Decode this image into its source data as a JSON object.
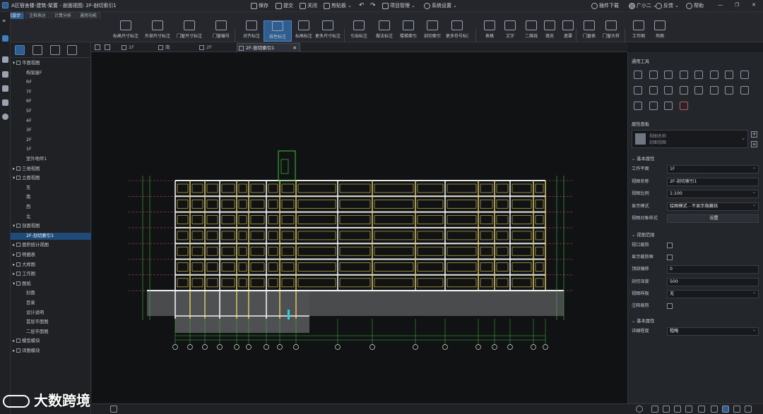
{
  "titlebar": {
    "doc_title": "A区宿舍楼-建筑-架置 - 剖面视图: 2F-剖切索引1",
    "save": "保存",
    "submit": "提交",
    "close": "关闭",
    "clipboard": "剪贴板",
    "project_mgmt": "项目管理",
    "system_settings": "系统设置",
    "plugin_download": "插件下载",
    "user": "广小二",
    "feedback": "反馈",
    "help": "帮助"
  },
  "ribbon_tabs": [
    "建筑设计",
    "注释表达",
    "计算分析",
    "通用功能"
  ],
  "ribbon_buttons": [
    "标高尺寸标注",
    "外部尺寸标注",
    "门窗尺寸标注",
    "门窗编号",
    "对齐标注",
    "线性标注",
    "标高标注",
    "更多尺寸标注",
    "引出标注",
    "做法标注",
    "楼梯索引",
    "剖切索引",
    "更多符号标注",
    "表格",
    "文字",
    "二维线",
    "填充",
    "遮罩",
    "门窗表",
    "门窗大样",
    "工作图",
    "布图"
  ],
  "tree": [
    {
      "label": "平面视图",
      "level": 0,
      "expanded": true
    },
    {
      "label": "构架屋F",
      "level": 1
    },
    {
      "label": "RF",
      "level": 1
    },
    {
      "label": "7F",
      "level": 1
    },
    {
      "label": "6F",
      "level": 1
    },
    {
      "label": "5F",
      "level": 1
    },
    {
      "label": "4F",
      "level": 1
    },
    {
      "label": "3F",
      "level": 1
    },
    {
      "label": "2F",
      "level": 1
    },
    {
      "label": "1F",
      "level": 1
    },
    {
      "label": "室外地坪1",
      "level": 1
    },
    {
      "label": "三维视图",
      "level": 0,
      "expanded": false
    },
    {
      "label": "立面视图",
      "level": 0,
      "expanded": true
    },
    {
      "label": "东",
      "level": 1
    },
    {
      "label": "南",
      "level": 1
    },
    {
      "label": "西",
      "level": 1
    },
    {
      "label": "北",
      "level": 1
    },
    {
      "label": "剖面视图",
      "level": 0,
      "expanded": true
    },
    {
      "label": "2F-剖切索引1",
      "level": 1,
      "selected": true
    },
    {
      "label": "面积统计视图",
      "level": 0
    },
    {
      "label": "明细表",
      "level": 0
    },
    {
      "label": "大样图",
      "level": 0
    },
    {
      "label": "工作图",
      "level": 0
    },
    {
      "label": "图纸",
      "level": 0,
      "expanded": true
    },
    {
      "label": "封面",
      "level": 1
    },
    {
      "label": "目录",
      "level": 1
    },
    {
      "label": "设计说明",
      "level": 1
    },
    {
      "label": "首层平面图",
      "level": 1
    },
    {
      "label": "二层平面图",
      "level": 1
    },
    {
      "label": "模型模块",
      "level": 0
    },
    {
      "label": "详图模块",
      "level": 0
    }
  ],
  "doc_tabs": [
    "1F",
    "南",
    "2F",
    "2F-剖切索引1"
  ],
  "right_panel": {
    "tools_title": "通用工具",
    "props_title": "属性面板",
    "view_name_hint": "视图名称",
    "view_type_hint": "剖面视图",
    "basic_props": "基本属性",
    "view_range": "视图范围",
    "basic_props2": "基本属性",
    "props": [
      {
        "label": "工作平面",
        "value": "1F",
        "type": "select"
      },
      {
        "label": "视图名称",
        "value": "2F-剖切索引1",
        "type": "text"
      },
      {
        "label": "视图比例",
        "value": "1:100",
        "type": "select"
      },
      {
        "label": "显示模式",
        "value": "绘图模式 - 不显示隐藏线",
        "type": "select"
      },
      {
        "label": "视图对象样式",
        "value": "设置",
        "type": "button"
      }
    ],
    "range_props": [
      {
        "label": "视口裁剪",
        "type": "check"
      },
      {
        "label": "显示裁剪框",
        "type": "check"
      },
      {
        "label": "顶部偏移",
        "value": "0",
        "type": "text"
      },
      {
        "label": "剖切深度",
        "value": "500",
        "type": "text"
      },
      {
        "label": "视图样板",
        "value": "无",
        "type": "select"
      },
      {
        "label": "注释裁剪",
        "type": "check"
      }
    ],
    "detail_level_label": "详细程度",
    "detail_level_value": "粗略"
  },
  "watermark": "大数跨境",
  "colors": {
    "accent": "#2f5d8f",
    "bg": "#1a1c20",
    "canvas": "#101214"
  }
}
